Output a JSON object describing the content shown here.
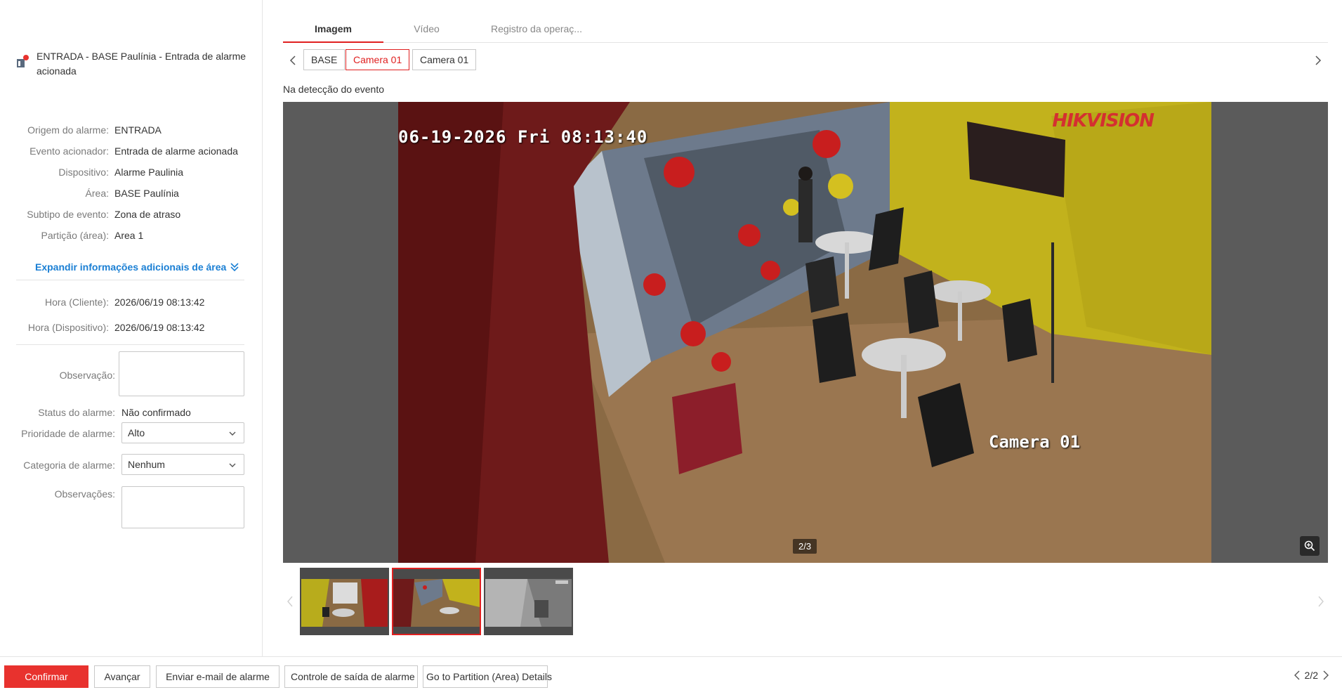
{
  "alarm": {
    "title": "ENTRADA - BASE Paulínia - Entrada de alarme acionada"
  },
  "info": [
    {
      "label": "Origem do alarme:",
      "value": "ENTRADA"
    },
    {
      "label": "Evento acionador:",
      "value": "Entrada de alarme acionada"
    },
    {
      "label": "Dispositivo:",
      "value": "Alarme Paulinia"
    },
    {
      "label": "Área:",
      "value": "BASE Paulínia"
    },
    {
      "label": "Subtipo de evento:",
      "value": "Zona de atraso"
    },
    {
      "label": "Partição (área):",
      "value": "Area 1"
    }
  ],
  "expand_label": "Expandir informações adicionais de área",
  "times": [
    {
      "label": "Hora (Cliente):",
      "value": "2026/06/19 08:13:42"
    },
    {
      "label": "Hora (Dispositivo):",
      "value": "2026/06/19 08:13:42"
    }
  ],
  "form": {
    "observacao_label": "Observação:",
    "observacao_value": "",
    "status_label": "Status do alarme:",
    "status_value": "Não confirmado",
    "priority_label": "Prioridade de alarme:",
    "priority_value": "Alto",
    "category_label": "Categoria de alarme:",
    "category_value": "Nenhum",
    "observacoes_label": "Observações:",
    "observacoes_value": ""
  },
  "tabs": [
    "Imagem",
    "Vídeo",
    "Registro da operaç..."
  ],
  "cameras": [
    "BASE",
    "Camera 01",
    "Camera 01"
  ],
  "detect_label": "Na detecção do evento",
  "viewer": {
    "osd_time": "06-19-2026 Fri 08:13:40",
    "osd_logo": "HIKVISION",
    "osd_camera": "Camera 01",
    "page_indicator": "2/3"
  },
  "footer": {
    "confirm": "Confirmar",
    "advance": "Avançar",
    "email": "Enviar e-mail de alarme",
    "output": "Controle de saída de alarme",
    "partition": "Go to Partition (Area) Details",
    "pager": "2/2"
  },
  "colors": {
    "accent": "#e8322e",
    "link": "#1a7fd4"
  }
}
